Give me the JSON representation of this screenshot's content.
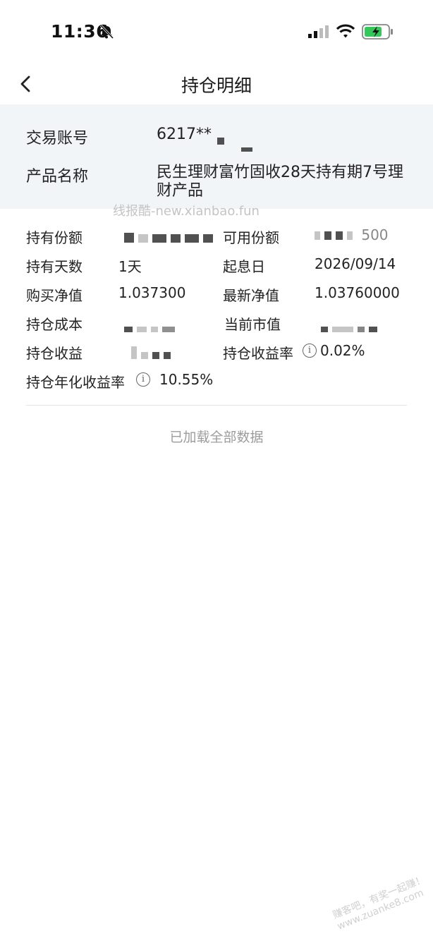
{
  "status_bar": {
    "time": "11:36"
  },
  "header": {
    "title": "持仓明细"
  },
  "info": {
    "account_label": "交易账号",
    "account_value": "6217**",
    "product_label": "产品名称",
    "product_value": "民生理财富竹固收28天持有期7号理财产品"
  },
  "watermark_text": "线报酷-new.xianbao.fun",
  "details": {
    "holding_shares_label": "持有份额",
    "available_shares_label": "可用份额",
    "available_shares_suffix": "500",
    "holding_days_label": "持有天数",
    "holding_days_value": "1天",
    "start_date_label": "起息日",
    "start_date_value": "2026/09/14",
    "buy_nav_label": "购买净值",
    "buy_nav_value": "1.037300",
    "latest_nav_label": "最新净值",
    "latest_nav_value": "1.03760000",
    "cost_label": "持仓成本",
    "market_value_label": "当前市值",
    "profit_label": "持仓收益",
    "profit_rate_label": "持仓收益率",
    "profit_rate_value": "0.02%",
    "annual_rate_label": "持仓年化收益率",
    "annual_rate_value": "10.55%"
  },
  "footer_note": "已加载全部数据",
  "bottom_watermark": "赚客吧，有奖一起赚！ www.zuanke8.com"
}
